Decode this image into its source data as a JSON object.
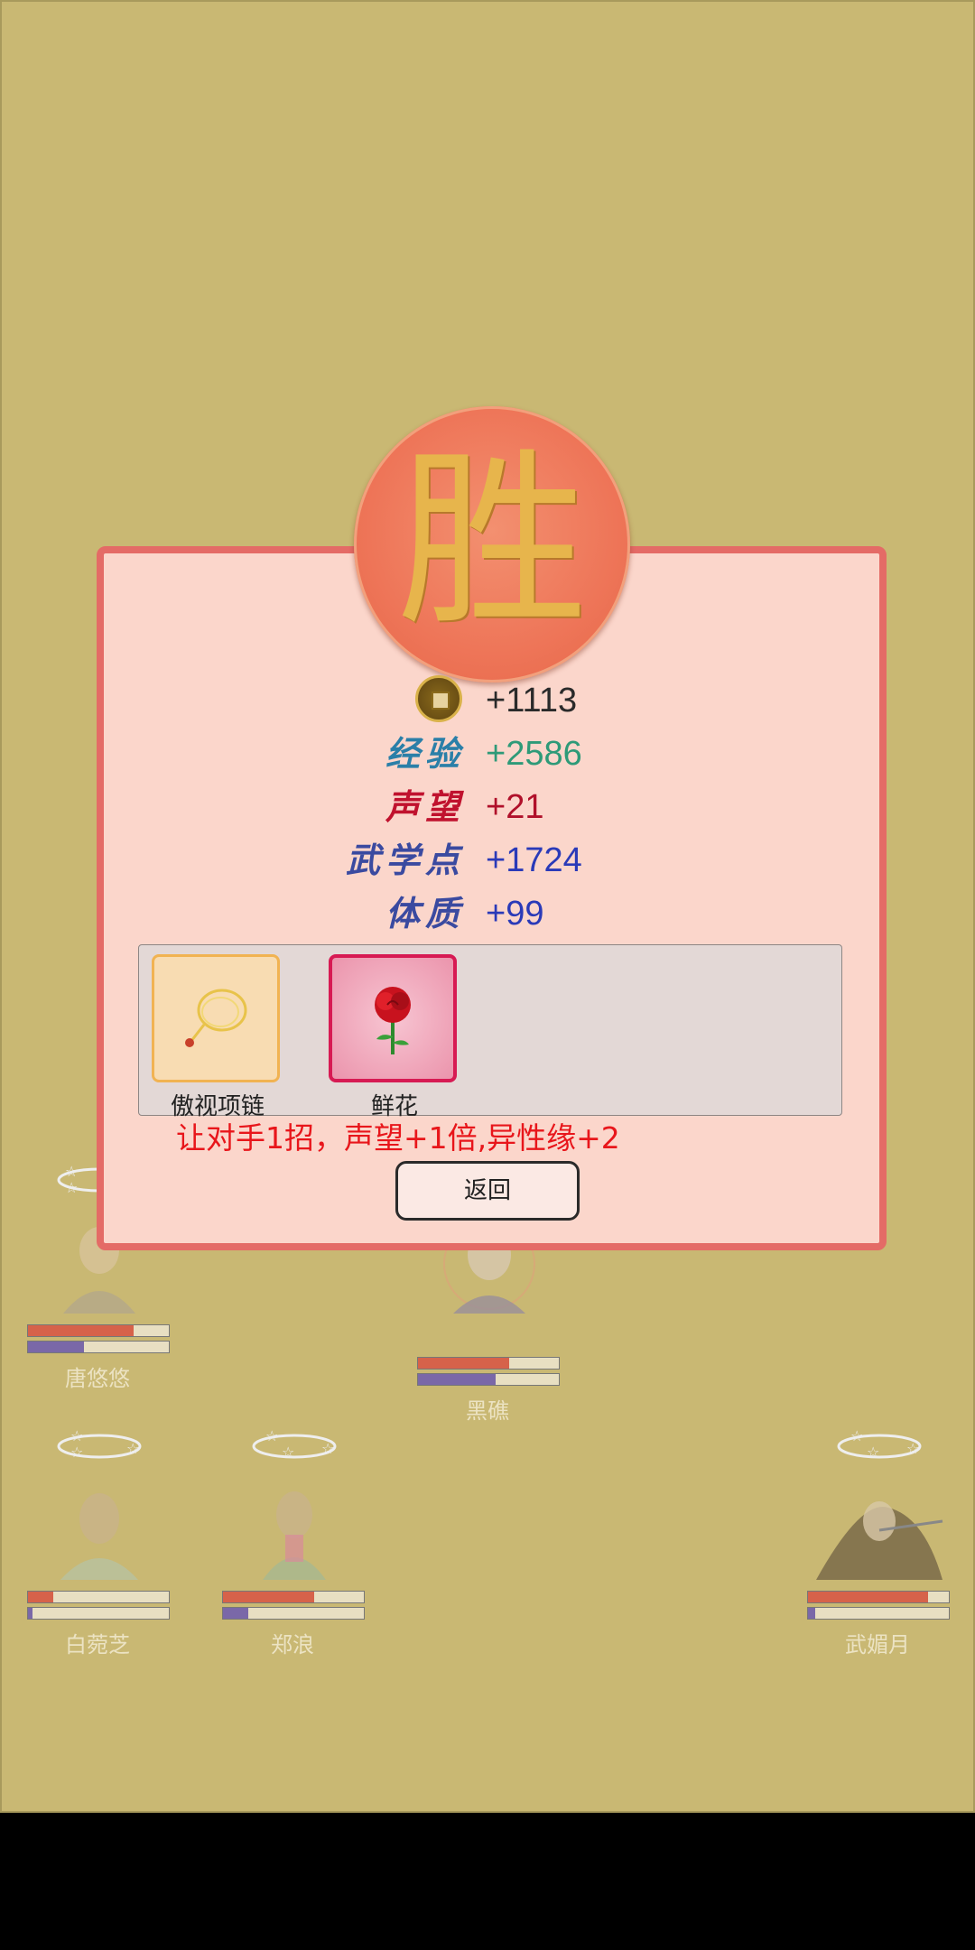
{
  "result": {
    "medal_char": "胜",
    "rewards": [
      {
        "icon": "coin-icon",
        "label": "",
        "value": "+1113",
        "color": "#2a2a2a"
      },
      {
        "label": "经验",
        "value": "+2586",
        "color": "#2e9a78",
        "label_color": "#2a7fa8"
      },
      {
        "label": "声望",
        "value": "+21",
        "color": "#b0102a",
        "label_color": "#c0122e"
      },
      {
        "label": "武学点",
        "value": "+1724",
        "color": "#2a3ab8",
        "label_color": "#3a4aa0"
      },
      {
        "label": "体质",
        "value": "+99",
        "color": "#2a3ab8",
        "label_color": "#3a4aa0"
      }
    ],
    "items": [
      {
        "name": "傲视项链",
        "icon": "necklace-icon"
      },
      {
        "name": "鲜花",
        "icon": "rose-icon"
      }
    ],
    "note": "让对手1招，声望+1倍,异性缘+2",
    "back_label": "返回"
  },
  "characters": [
    {
      "name": "唐悠悠",
      "hp": 0.75,
      "mp": 0.4
    },
    {
      "name": "黑礁",
      "hp": 0.65,
      "mp": 0.55
    },
    {
      "name": "白菀芝",
      "hp": 0.18,
      "mp": 0.03
    },
    {
      "name": "郑浪",
      "hp": 0.65,
      "mp": 0.18
    },
    {
      "name": "武媚月",
      "hp": 0.85,
      "mp": 0.05
    }
  ]
}
